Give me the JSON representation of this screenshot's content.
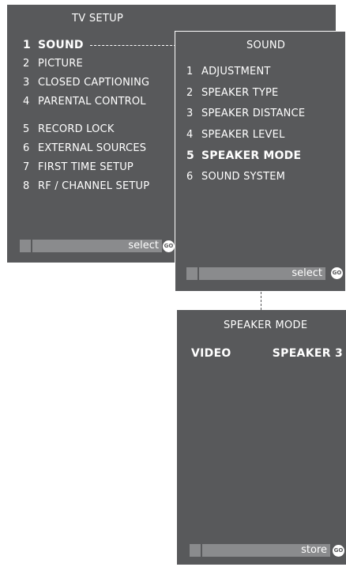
{
  "tv_setup": {
    "title": "TV SETUP",
    "items": [
      {
        "num": "1",
        "label": "SOUND",
        "selected": true
      },
      {
        "num": "2",
        "label": "PICTURE"
      },
      {
        "num": "3",
        "label": "CLOSED CAPTIONING"
      },
      {
        "num": "4",
        "label": "PARENTAL CONTROL"
      },
      {
        "num": "5",
        "label": "RECORD LOCK"
      },
      {
        "num": "6",
        "label": "EXTERNAL SOURCES"
      },
      {
        "num": "7",
        "label": "FIRST TIME SETUP"
      },
      {
        "num": "8",
        "label": "RF / CHANNEL SETUP"
      }
    ],
    "action": "select",
    "go": "GO"
  },
  "sound": {
    "title": "SOUND",
    "items": [
      {
        "num": "1",
        "label": "ADJUSTMENT"
      },
      {
        "num": "2",
        "label": "SPEAKER  TYPE"
      },
      {
        "num": "3",
        "label": "SPEAKER  DISTANCE"
      },
      {
        "num": "4",
        "label": "SPEAKER  LEVEL"
      },
      {
        "num": "5",
        "label": "SPEAKER  MODE",
        "selected": true
      },
      {
        "num": "6",
        "label": "SOUND  SYSTEM"
      }
    ],
    "action": "select",
    "go": "GO"
  },
  "speaker_mode": {
    "title": "SPEAKER  MODE",
    "source": "VIDEO",
    "value": "SPEAKER 3",
    "action": "store",
    "go": "GO"
  }
}
